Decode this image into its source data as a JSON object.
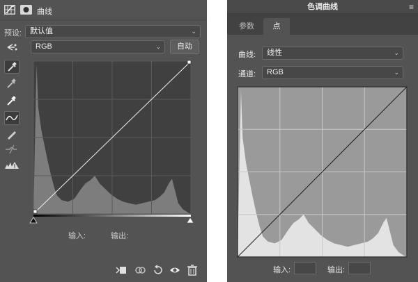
{
  "left_panel": {
    "title": "曲线",
    "preset_label": "预设:",
    "preset_value": "默认值",
    "channel_value": "RGB",
    "auto_button": "自动",
    "input_label": "输入:",
    "output_label": "输出:"
  },
  "right_panel": {
    "title": "色调曲线",
    "tabs": [
      "参数",
      "点"
    ],
    "active_tab": "点",
    "curve_label": "曲线:",
    "curve_value": "线性",
    "channel_label": "通道:",
    "channel_value": "RGB",
    "input_label": "输入:",
    "output_label": "输出:"
  },
  "histogram_profile": [
    [
      0,
      0
    ],
    [
      0.02,
      0.98
    ],
    [
      0.03,
      0.7
    ],
    [
      0.05,
      0.55
    ],
    [
      0.07,
      0.45
    ],
    [
      0.09,
      0.35
    ],
    [
      0.11,
      0.26
    ],
    [
      0.13,
      0.18
    ],
    [
      0.15,
      0.12
    ],
    [
      0.18,
      0.09
    ],
    [
      0.22,
      0.08
    ],
    [
      0.26,
      0.1
    ],
    [
      0.3,
      0.16
    ],
    [
      0.33,
      0.2
    ],
    [
      0.36,
      0.22
    ],
    [
      0.39,
      0.25
    ],
    [
      0.42,
      0.2
    ],
    [
      0.45,
      0.17
    ],
    [
      0.49,
      0.13
    ],
    [
      0.53,
      0.1
    ],
    [
      0.57,
      0.08
    ],
    [
      0.61,
      0.07
    ],
    [
      0.65,
      0.06
    ],
    [
      0.69,
      0.07
    ],
    [
      0.73,
      0.08
    ],
    [
      0.77,
      0.09
    ],
    [
      0.8,
      0.11
    ],
    [
      0.83,
      0.14
    ],
    [
      0.86,
      0.2
    ],
    [
      0.88,
      0.23
    ],
    [
      0.9,
      0.15
    ],
    [
      0.92,
      0.07
    ],
    [
      0.95,
      0.03
    ],
    [
      0.98,
      0.01
    ],
    [
      1,
      0
    ]
  ],
  "colors": {
    "panel_bg": "#535353",
    "left_graph_bg": "#404040",
    "left_histogram": "#7d7d7d",
    "right_graph_bg": "#9a9a9a",
    "right_histogram": "#e3e3e3",
    "curve_light": "#f2f2f2",
    "curve_dark": "#1c1c1c"
  }
}
